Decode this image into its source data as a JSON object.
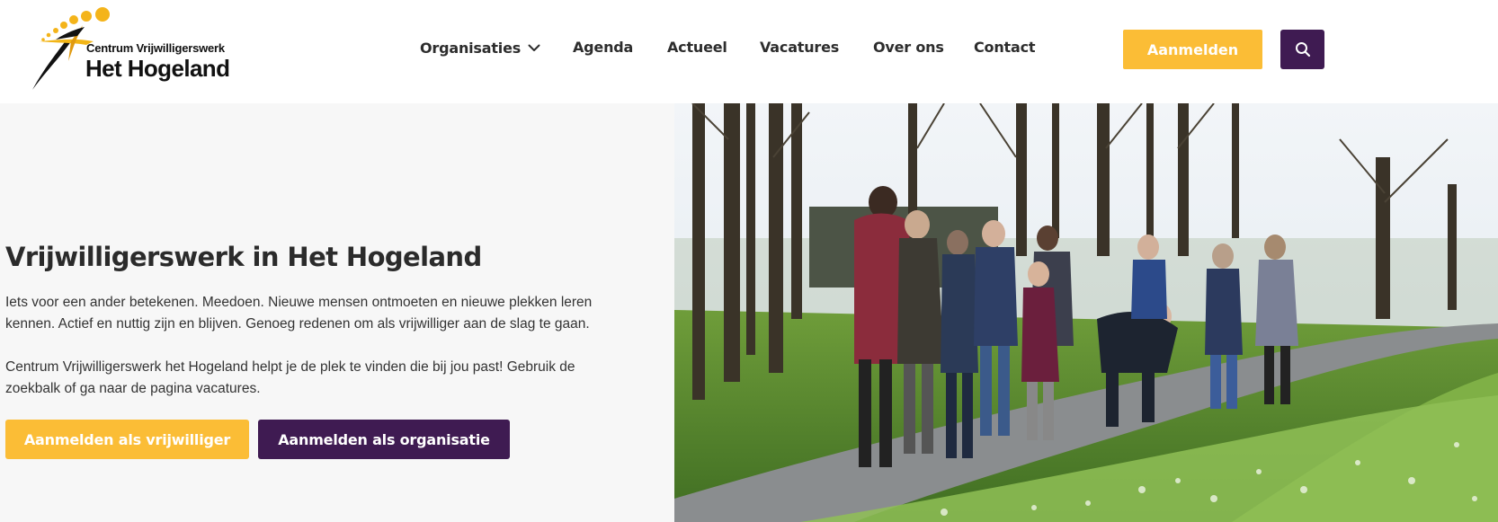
{
  "header": {
    "logo": {
      "line1": "Centrum Vrijwilligerswerk",
      "line2": "Het Hogeland"
    },
    "nav": [
      {
        "label": "Organisaties",
        "has_dropdown": true
      },
      {
        "label": "Agenda"
      },
      {
        "label": "Actueel"
      },
      {
        "label": "Vacatures"
      },
      {
        "label": "Over ons"
      },
      {
        "label": "Contact"
      }
    ],
    "signup_label": "Aanmelden",
    "search_icon": "search-icon"
  },
  "hero": {
    "title": "Vrijwilligerswerk in Het Hogeland",
    "paragraph1": "Iets voor een ander betekenen. Meedoen. Nieuwe mensen ontmoeten en nieuwe plekken leren kennen. Actief en nuttig zijn en blijven. Genoeg redenen om als vrijwilliger aan de slag te gaan.",
    "paragraph2": "Centrum Vrijwilligerswerk het Hogeland helpt je de plek te vinden die bij jou past! Gebruik de zoekbalk of ga naar de pagina vacatures.",
    "btn_volunteer": "Aanmelden als vrijwilliger",
    "btn_organisation": "Aanmelden als organisatie"
  },
  "colors": {
    "accent_yellow": "#fbbd36",
    "accent_purple": "#3f1b52",
    "hero_bg": "#f7f7f7"
  }
}
